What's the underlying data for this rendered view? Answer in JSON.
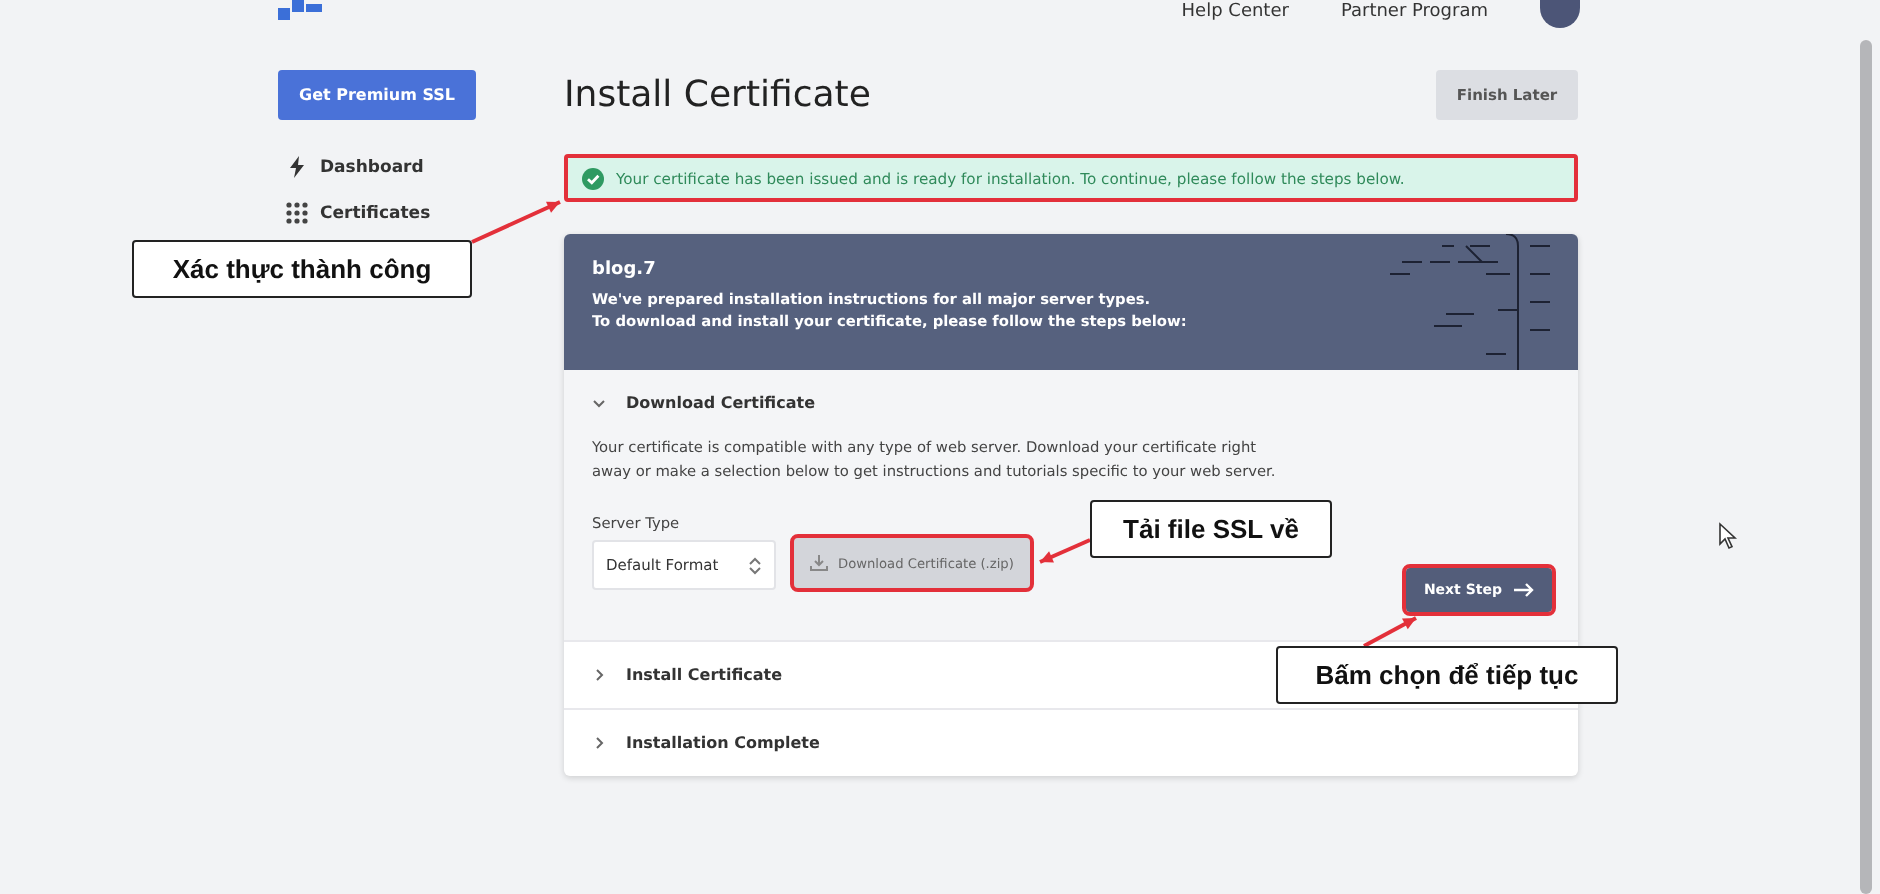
{
  "header": {
    "nav_links": [
      "Help Center",
      "Partner Program"
    ]
  },
  "sidebar": {
    "cta_button": "Get Premium SSL",
    "items": [
      {
        "label": "Dashboard",
        "kind": "bolt"
      },
      {
        "label": "Certificates",
        "kind": "grid"
      }
    ]
  },
  "page": {
    "title": "Install Certificate",
    "finish_button": "Finish Later"
  },
  "alert": {
    "text": "Your certificate has been issued and is ready for installation. To continue, please follow the steps below.",
    "highlighted": true
  },
  "card": {
    "domain": "blog.7",
    "intro_lines": [
      "We've prepared installation instructions for all major server types.",
      "To download and install your certificate, please follow the steps below:"
    ]
  },
  "steps": [
    {
      "title": "Download Certificate",
      "expanded": true,
      "description": "Your certificate is compatible with any type of web server. Download your certificate right away or make a selection below to get instructions and tutorials specific to your web server.",
      "field_label": "Server Type",
      "select_value": "Default Format",
      "download_button": {
        "label": "Download Certificate (.zip)",
        "highlighted": true
      },
      "next_button": {
        "label": "Next Step",
        "highlighted": true
      }
    },
    {
      "title": "Install Certificate",
      "expanded": false
    },
    {
      "title": "Installation Complete",
      "expanded": false
    }
  ],
  "annotations": [
    {
      "text": "Xác thực thành công"
    },
    {
      "text": "Tải file SSL về"
    },
    {
      "text": "Bấm chọn để tiếp tục"
    }
  ]
}
